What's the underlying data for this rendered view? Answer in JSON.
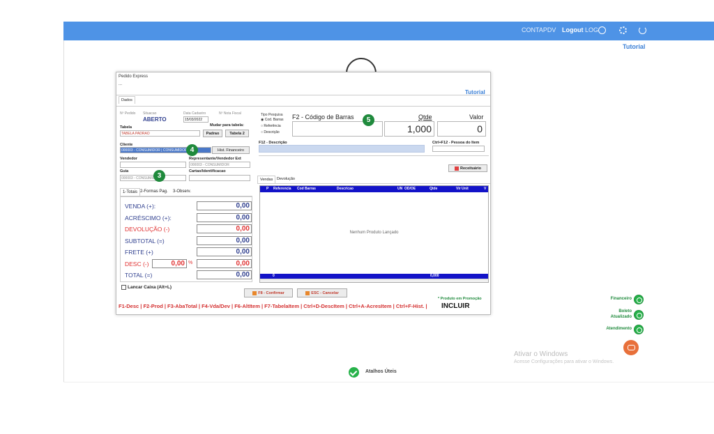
{
  "topbar": {
    "contapdv": "CONTAPDV",
    "logout": "Logout",
    "log": "LOG",
    "tutorial": "Tutorial"
  },
  "window": {
    "title": "Pedido Express",
    "subtitle": "...",
    "tutorial": "Tutorial",
    "tab_dados": "Dados",
    "pedido": {
      "n_pedido_label": "Nº Pedido",
      "situacao_label": "Situacao",
      "situacao_value": "ABERTO",
      "data_cadastro_label": "Data Cadastro",
      "data_cadastro_value": "15/03/2022",
      "nota_fiscal_label": "Nº Nota Fiscal",
      "mudar_tabela_label": "Mudar para tabela:"
    },
    "tabela": {
      "label": "Tabela",
      "value": "TABELA PADRAO",
      "padrao_btn": "Padrao",
      "tabela2_btn": "Tabela 2"
    },
    "cliente": {
      "label": "Cliente",
      "value": "000003 - CONSUMIDOR | CONSUMIDOR",
      "hist_btn": "Hist. Financeiro"
    },
    "vendedor": {
      "label": "Vendedor",
      "value": ""
    },
    "representante": {
      "label": "Representante/Vendedor Ext",
      "value": "000003 - CONSUMIDOR"
    },
    "guia": {
      "label": "Guia",
      "value": "000003 - CONSUMIDOR"
    },
    "cartao": {
      "label": "Cartao/Identificacao",
      "value": ""
    },
    "tipo_pesquisa": {
      "label": "Tipo Pesquisa",
      "options": [
        "Cod. Barras",
        "Referência",
        "Descrição"
      ]
    },
    "f2_label": "F2 - Código de Barras",
    "qtde_label": "Qtde",
    "qtde_value": "1,000",
    "valor_label": "Valor",
    "valor_value": "0",
    "f12_label": "F12 - Descrição",
    "ctrl_f12_label": "Ctrl+F12 - Pessoa do Item",
    "receituario_btn": "Receituário",
    "markers": {
      "m3": "3",
      "m4": "4",
      "m5": "5"
    },
    "total_tabs": [
      "1-Totais",
      "2-Formas Pag.",
      "3-Observ."
    ],
    "totals": [
      {
        "label": "VENDA (+):",
        "value": "0,00"
      },
      {
        "label": "ACRÉSCIMO (+):",
        "value": "0,00"
      },
      {
        "label": "DEVOLUÇÃO (-)",
        "value": "0,00"
      },
      {
        "label": "SUBTOTAL (=)",
        "value": "0,00"
      },
      {
        "label": "FRETE (+)",
        "value": "0,00"
      },
      {
        "label": "DESC (-)",
        "value": "0,00",
        "pct_value": "0,00",
        "pct_sign": "%"
      },
      {
        "label": "TOTAL (=)",
        "value": "0,00"
      }
    ],
    "lancar_caixa": "Lancar Caixa (Alt+L)",
    "grid_tabs": [
      "Vendas",
      "Devolução"
    ],
    "grid_columns": [
      "P",
      "Referencia",
      "Cod Barras",
      "Descricao",
      "UN",
      "OD/OE",
      "Qtde",
      "Vlr Unit",
      "V"
    ],
    "grid_empty": "Nenhum Produto Lançado",
    "grid_footer": {
      "count": "0",
      "total": "0,000"
    },
    "confirmar_btn": "F8 - Confirmar",
    "cancelar_btn": "ESC - Cancelar",
    "promocao_note": "* Produto em Promoção",
    "fkeys": "F1-Desc | F2-Prod | F3-AbaTotal | F4-Vda/Dev | F6-AltItem | F7-TabelaItem | Ctrl+D-DescItem | Ctrl+A-AcresItem | Ctrl+F-Hist. |",
    "incluir": "INCLUIR"
  },
  "sidebar": {
    "financeiro": "Financeiro",
    "boleto": "Boleto",
    "atualizado": "Atualizado",
    "atendimento": "Atendimento"
  },
  "windows_activation": {
    "title": "Ativar o Windows",
    "subtitle": "Acesse Configurações para ativar o Windows."
  },
  "atalhos": "Atalhos Úteis"
}
